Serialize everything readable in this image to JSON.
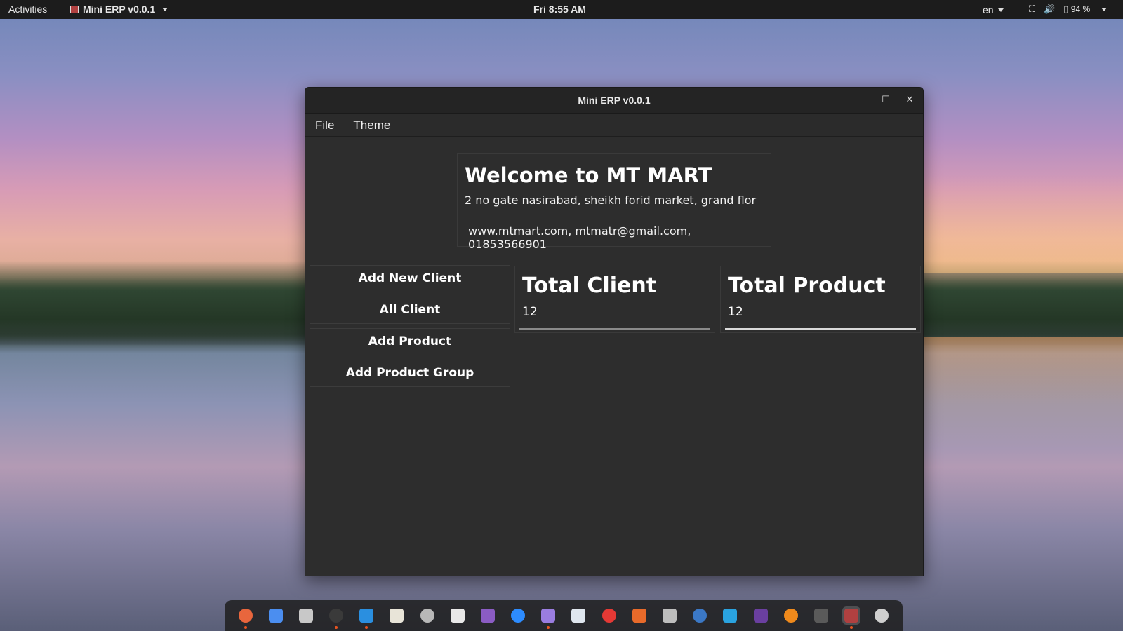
{
  "topbar": {
    "activities": "Activities",
    "app_name": "Mini ERP v0.0.1",
    "clock": "Fri  8:55 AM",
    "lang": "en",
    "battery": "94 %"
  },
  "window": {
    "title": "Mini ERP v0.0.1",
    "menu": [
      "File",
      "Theme"
    ]
  },
  "welcome": {
    "heading": "Welcome to MT MART",
    "address": "2 no gate nasirabad,  sheikh forid market, grand flor",
    "contact": "www.mtmart.com, mtmatr@gmail.com, 01853566901"
  },
  "actions": {
    "add_client": "Add New Client",
    "all_client": "All Client",
    "add_product": "Add Product",
    "add_product_group": "Add Product Group"
  },
  "stats": {
    "client": {
      "label": "Total Client",
      "value": "12"
    },
    "product": {
      "label": "Total Product",
      "value": "12"
    }
  },
  "dock": {
    "apps": [
      {
        "icon": "firefox-icon",
        "color": "#e8663d"
      },
      {
        "icon": "chrome-icon",
        "color": "#4b8ef0"
      },
      {
        "icon": "files-icon",
        "color": "#c8c8c8"
      },
      {
        "icon": "terminal-icon",
        "color": "#3a3a3a"
      },
      {
        "icon": "vscode-icon",
        "color": "#2a8fe0"
      },
      {
        "icon": "text-editor-icon",
        "color": "#e8e4d8"
      },
      {
        "icon": "screenshot-icon",
        "color": "#b8b8b8"
      },
      {
        "icon": "slack-icon",
        "color": "#e8e8e8"
      },
      {
        "icon": "video-editor-icon",
        "color": "#8b5cc4"
      },
      {
        "icon": "zoom-icon",
        "color": "#2d8cff"
      },
      {
        "icon": "obsidian-icon",
        "color": "#9a7de0"
      },
      {
        "icon": "document-viewer-icon",
        "color": "#dfe6ee"
      },
      {
        "icon": "anydesk-icon",
        "color": "#e53935"
      },
      {
        "icon": "software-center-icon",
        "color": "#e86a2a"
      },
      {
        "icon": "calculator-icon",
        "color": "#bdbdbd"
      },
      {
        "icon": "qbittorrent-icon",
        "color": "#3b78c6"
      },
      {
        "icon": "telegram-icon",
        "color": "#2aa3e0"
      },
      {
        "icon": "kdenlive-icon",
        "color": "#6a3fa0"
      },
      {
        "icon": "vlc-icon",
        "color": "#f08a1c"
      },
      {
        "icon": "clapper-icon",
        "color": "#5a5a5a"
      },
      {
        "icon": "mini-erp-icon",
        "color": "#b04040"
      },
      {
        "icon": "app-grid-icon",
        "color": "#cfcfcf"
      }
    ]
  }
}
